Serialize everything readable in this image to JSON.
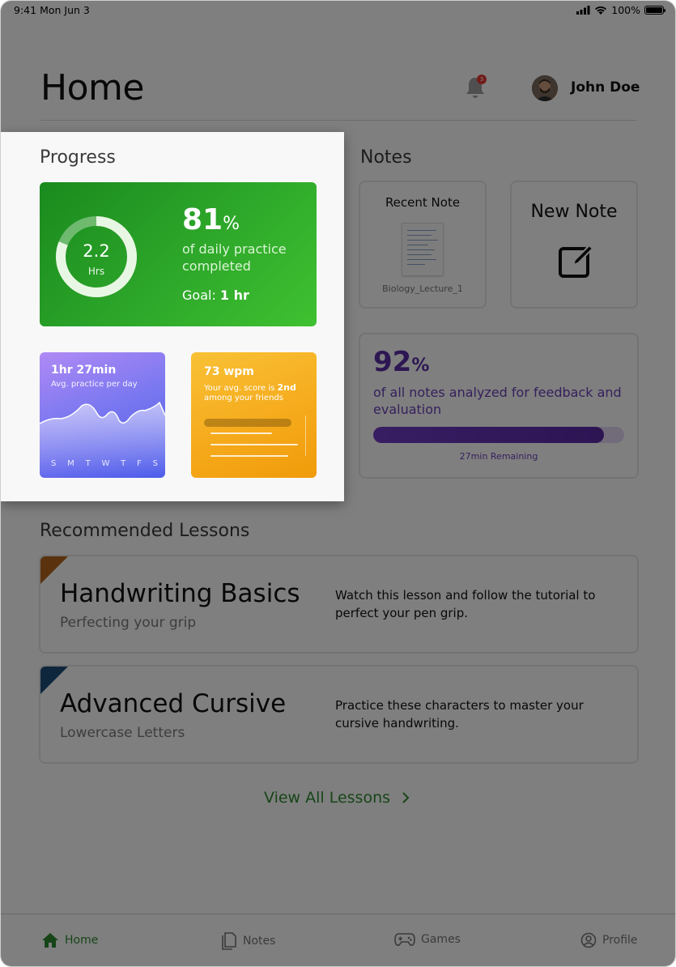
{
  "status_bar": {
    "time": "9:41",
    "date": "Mon Jun 3",
    "battery": "100%"
  },
  "header": {
    "title": "Home",
    "notification_count": "3",
    "user_name": "John Doe"
  },
  "progress": {
    "title": "Progress",
    "daily": {
      "hours_value": "2.2",
      "hours_unit": "Hrs",
      "percent_value": "81",
      "percent_sign": "%",
      "percent_text": "of daily practice completed",
      "goal_label": "Goal:",
      "goal_value": "1 hr",
      "ring_fraction": 0.81
    },
    "practice_card": {
      "title": "1hr 27min",
      "subtitle": "Avg. practice per day",
      "days": [
        "S",
        "M",
        "T",
        "W",
        "T",
        "F",
        "S"
      ]
    },
    "speed_card": {
      "title": "73 wpm",
      "subtitle_prefix": "Your avg. score is",
      "rank": "2nd",
      "subtitle_suffix": "among your friends"
    }
  },
  "notes": {
    "title": "Notes",
    "recent": {
      "title": "Recent Note",
      "filename": "Biology_Lecture_1"
    },
    "new_note": {
      "title": "New Note"
    },
    "analysis": {
      "percent_value": "92",
      "percent_sign": "%",
      "text": "of all notes analyzed for feedback and evaluation",
      "progress_fraction": 0.92,
      "remaining": "27min Remaining"
    }
  },
  "lessons": {
    "title": "Recommended Lessons",
    "items": [
      {
        "title": "Handwriting Basics",
        "subtitle": "Perfecting your grip",
        "description": "Watch this lesson and follow the tutorial to perfect your pen grip.",
        "accent": "#b5651d"
      },
      {
        "title": "Advanced Cursive",
        "subtitle": "Lowercase Letters",
        "description": "Practice these characters to master your cursive handwriting.",
        "accent": "#1f4e79"
      }
    ],
    "view_all": "View All Lessons"
  },
  "tabs": [
    {
      "label": "Home",
      "icon": "home-icon",
      "active": true
    },
    {
      "label": "Notes",
      "icon": "notes-icon",
      "active": false
    },
    {
      "label": "Games",
      "icon": "gamepad-icon",
      "active": false
    },
    {
      "label": "Profile",
      "icon": "profile-icon",
      "active": false
    }
  ],
  "colors": {
    "accent_green": "#2e8b2e",
    "accent_purple": "#5b2ea6",
    "overlay": "rgba(0,0,0,0.5)"
  }
}
